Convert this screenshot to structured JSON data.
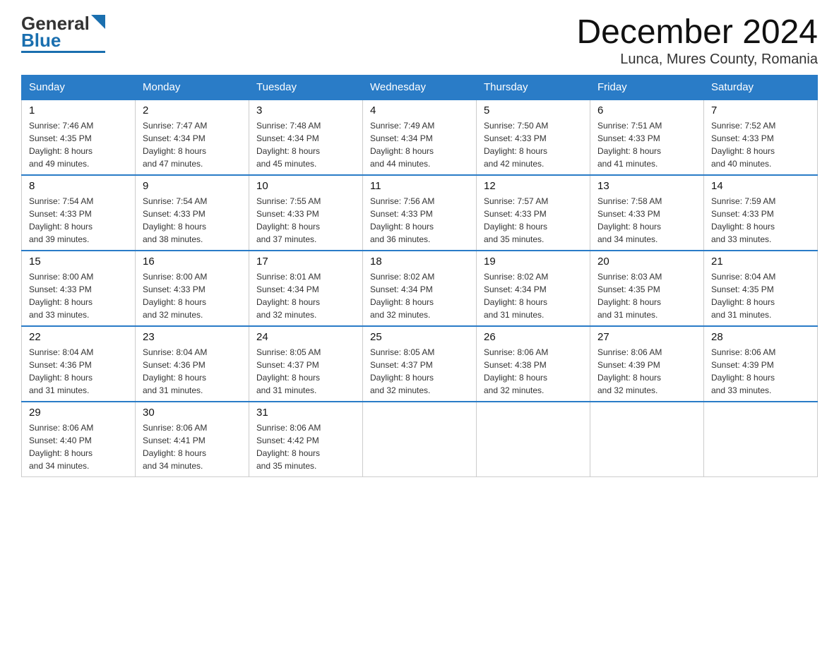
{
  "logo": {
    "general": "General",
    "blue": "Blue"
  },
  "title": "December 2024",
  "subtitle": "Lunca, Mures County, Romania",
  "days_of_week": [
    "Sunday",
    "Monday",
    "Tuesday",
    "Wednesday",
    "Thursday",
    "Friday",
    "Saturday"
  ],
  "weeks": [
    [
      {
        "day": "1",
        "info": "Sunrise: 7:46 AM\nSunset: 4:35 PM\nDaylight: 8 hours\nand 49 minutes."
      },
      {
        "day": "2",
        "info": "Sunrise: 7:47 AM\nSunset: 4:34 PM\nDaylight: 8 hours\nand 47 minutes."
      },
      {
        "day": "3",
        "info": "Sunrise: 7:48 AM\nSunset: 4:34 PM\nDaylight: 8 hours\nand 45 minutes."
      },
      {
        "day": "4",
        "info": "Sunrise: 7:49 AM\nSunset: 4:34 PM\nDaylight: 8 hours\nand 44 minutes."
      },
      {
        "day": "5",
        "info": "Sunrise: 7:50 AM\nSunset: 4:33 PM\nDaylight: 8 hours\nand 42 minutes."
      },
      {
        "day": "6",
        "info": "Sunrise: 7:51 AM\nSunset: 4:33 PM\nDaylight: 8 hours\nand 41 minutes."
      },
      {
        "day": "7",
        "info": "Sunrise: 7:52 AM\nSunset: 4:33 PM\nDaylight: 8 hours\nand 40 minutes."
      }
    ],
    [
      {
        "day": "8",
        "info": "Sunrise: 7:54 AM\nSunset: 4:33 PM\nDaylight: 8 hours\nand 39 minutes."
      },
      {
        "day": "9",
        "info": "Sunrise: 7:54 AM\nSunset: 4:33 PM\nDaylight: 8 hours\nand 38 minutes."
      },
      {
        "day": "10",
        "info": "Sunrise: 7:55 AM\nSunset: 4:33 PM\nDaylight: 8 hours\nand 37 minutes."
      },
      {
        "day": "11",
        "info": "Sunrise: 7:56 AM\nSunset: 4:33 PM\nDaylight: 8 hours\nand 36 minutes."
      },
      {
        "day": "12",
        "info": "Sunrise: 7:57 AM\nSunset: 4:33 PM\nDaylight: 8 hours\nand 35 minutes."
      },
      {
        "day": "13",
        "info": "Sunrise: 7:58 AM\nSunset: 4:33 PM\nDaylight: 8 hours\nand 34 minutes."
      },
      {
        "day": "14",
        "info": "Sunrise: 7:59 AM\nSunset: 4:33 PM\nDaylight: 8 hours\nand 33 minutes."
      }
    ],
    [
      {
        "day": "15",
        "info": "Sunrise: 8:00 AM\nSunset: 4:33 PM\nDaylight: 8 hours\nand 33 minutes."
      },
      {
        "day": "16",
        "info": "Sunrise: 8:00 AM\nSunset: 4:33 PM\nDaylight: 8 hours\nand 32 minutes."
      },
      {
        "day": "17",
        "info": "Sunrise: 8:01 AM\nSunset: 4:34 PM\nDaylight: 8 hours\nand 32 minutes."
      },
      {
        "day": "18",
        "info": "Sunrise: 8:02 AM\nSunset: 4:34 PM\nDaylight: 8 hours\nand 32 minutes."
      },
      {
        "day": "19",
        "info": "Sunrise: 8:02 AM\nSunset: 4:34 PM\nDaylight: 8 hours\nand 31 minutes."
      },
      {
        "day": "20",
        "info": "Sunrise: 8:03 AM\nSunset: 4:35 PM\nDaylight: 8 hours\nand 31 minutes."
      },
      {
        "day": "21",
        "info": "Sunrise: 8:04 AM\nSunset: 4:35 PM\nDaylight: 8 hours\nand 31 minutes."
      }
    ],
    [
      {
        "day": "22",
        "info": "Sunrise: 8:04 AM\nSunset: 4:36 PM\nDaylight: 8 hours\nand 31 minutes."
      },
      {
        "day": "23",
        "info": "Sunrise: 8:04 AM\nSunset: 4:36 PM\nDaylight: 8 hours\nand 31 minutes."
      },
      {
        "day": "24",
        "info": "Sunrise: 8:05 AM\nSunset: 4:37 PM\nDaylight: 8 hours\nand 31 minutes."
      },
      {
        "day": "25",
        "info": "Sunrise: 8:05 AM\nSunset: 4:37 PM\nDaylight: 8 hours\nand 32 minutes."
      },
      {
        "day": "26",
        "info": "Sunrise: 8:06 AM\nSunset: 4:38 PM\nDaylight: 8 hours\nand 32 minutes."
      },
      {
        "day": "27",
        "info": "Sunrise: 8:06 AM\nSunset: 4:39 PM\nDaylight: 8 hours\nand 32 minutes."
      },
      {
        "day": "28",
        "info": "Sunrise: 8:06 AM\nSunset: 4:39 PM\nDaylight: 8 hours\nand 33 minutes."
      }
    ],
    [
      {
        "day": "29",
        "info": "Sunrise: 8:06 AM\nSunset: 4:40 PM\nDaylight: 8 hours\nand 34 minutes."
      },
      {
        "day": "30",
        "info": "Sunrise: 8:06 AM\nSunset: 4:41 PM\nDaylight: 8 hours\nand 34 minutes."
      },
      {
        "day": "31",
        "info": "Sunrise: 8:06 AM\nSunset: 4:42 PM\nDaylight: 8 hours\nand 35 minutes."
      },
      null,
      null,
      null,
      null
    ]
  ]
}
